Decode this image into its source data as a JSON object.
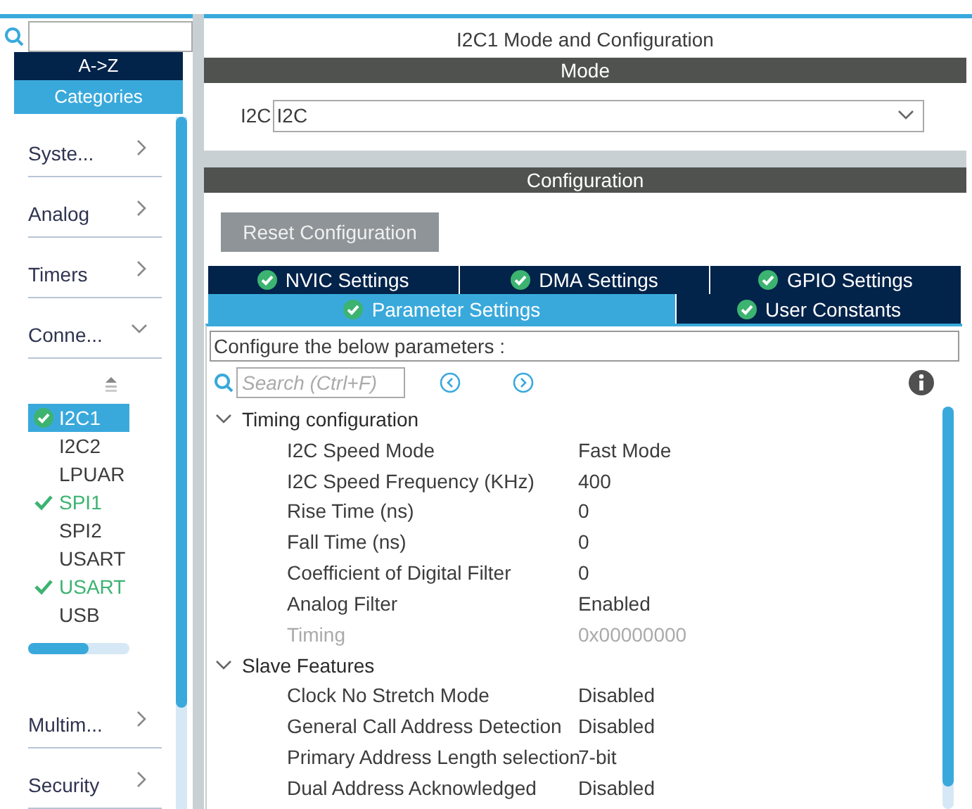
{
  "sidebar": {
    "sort_tabs": [
      {
        "label": "A->Z",
        "selected": false
      },
      {
        "label": "Categories",
        "selected": true
      }
    ],
    "categories": [
      {
        "label": "Syste...",
        "expanded": false
      },
      {
        "label": "Analog",
        "expanded": false
      },
      {
        "label": "Timers",
        "expanded": false
      },
      {
        "label": "Conne...",
        "expanded": true,
        "children": [
          {
            "label": "I2C1",
            "selected": true,
            "checked": true
          },
          {
            "label": "I2C2",
            "selected": false,
            "checked": false
          },
          {
            "label": "LPUAR",
            "selected": false,
            "checked": false
          },
          {
            "label": "SPI1",
            "selected": false,
            "checked": true
          },
          {
            "label": "SPI2",
            "selected": false,
            "checked": false
          },
          {
            "label": "USART",
            "selected": false,
            "checked": false
          },
          {
            "label": "USART",
            "selected": false,
            "checked": true
          },
          {
            "label": "USB",
            "selected": false,
            "checked": false
          }
        ]
      },
      {
        "label": "Multim...",
        "expanded": false
      },
      {
        "label": "Security",
        "expanded": false
      }
    ]
  },
  "window": {
    "title": "I2C1 Mode and Configuration"
  },
  "mode": {
    "header": "Mode",
    "label": "I2C",
    "value": "I2C"
  },
  "configuration": {
    "header": "Configuration",
    "reset_button": "Reset Configuration",
    "tab_rows": [
      [
        {
          "label": "NVIC Settings",
          "selected": false
        },
        {
          "label": "DMA Settings",
          "selected": false
        },
        {
          "label": "GPIO Settings",
          "selected": false
        }
      ],
      [
        {
          "label": "Parameter Settings",
          "selected": true
        },
        {
          "label": "User Constants",
          "selected": false
        }
      ]
    ],
    "description": "Configure the below parameters :",
    "search": {
      "placeholder": "Search (Ctrl+F)"
    },
    "groups": [
      {
        "label": "Timing configuration",
        "expanded": true,
        "children": [
          {
            "name": "I2C Speed Mode",
            "value": "Fast Mode",
            "disabled": false
          },
          {
            "name": "I2C Speed Frequency (KHz)",
            "value": "400",
            "disabled": false
          },
          {
            "name": "Rise Time (ns)",
            "value": "0",
            "disabled": false
          },
          {
            "name": "Fall Time (ns)",
            "value": "0",
            "disabled": false
          },
          {
            "name": "Coefficient of Digital Filter",
            "value": "0",
            "disabled": false
          },
          {
            "name": "Analog Filter",
            "value": "Enabled",
            "disabled": false
          },
          {
            "name": "Timing",
            "value": "0x00000000",
            "disabled": true
          }
        ]
      },
      {
        "label": "Slave Features",
        "expanded": true,
        "children": [
          {
            "name": "Clock No Stretch Mode",
            "value": "Disabled",
            "disabled": false
          },
          {
            "name": "General Call Address Detection",
            "value": "Disabled",
            "disabled": false
          },
          {
            "name": "Primary Address Length selection",
            "value": "7-bit",
            "disabled": false
          },
          {
            "name": "Dual Address Acknowledged",
            "value": "Disabled",
            "disabled": false
          }
        ]
      }
    ]
  }
}
